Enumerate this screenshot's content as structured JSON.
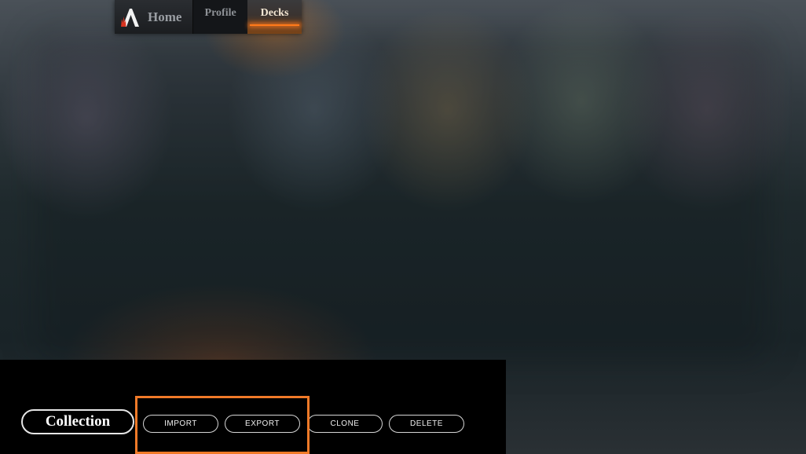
{
  "nav": {
    "home_label": "Home",
    "tabs": [
      {
        "label": "Profile",
        "active": false
      },
      {
        "label": "Decks",
        "active": true
      }
    ]
  },
  "bottom_bar": {
    "collection_label": "Collection",
    "buttons": [
      {
        "label": "IMPORT"
      },
      {
        "label": "EXPORT"
      },
      {
        "label": "CLONE"
      },
      {
        "label": "DELETE"
      }
    ]
  },
  "colors": {
    "accent": "#ff7a1a",
    "highlight_box": "#f07a28"
  }
}
